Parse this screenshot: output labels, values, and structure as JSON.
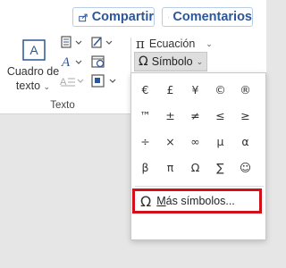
{
  "header": {
    "share_label": "Compartir",
    "comments_label": "Comentarios"
  },
  "ribbon": {
    "group_label": "Texto",
    "textbox_line1": "Cuadro de",
    "textbox_line2": "texto",
    "equation_label": "Ecuación",
    "symbol_label": "Símbolo"
  },
  "symbols": {
    "items": [
      "€",
      "£",
      "¥",
      "©",
      "®",
      "™",
      "±",
      "≠",
      "≤",
      "≥",
      "÷",
      "×",
      "∞",
      "µ",
      "α",
      "β",
      "π",
      "Ω",
      "∑",
      "☺"
    ],
    "more_label_prefix": "M",
    "more_label_rest": "ás símbolos..."
  },
  "colors": {
    "accent": "#2b579a",
    "highlight_border": "#d3101a"
  }
}
